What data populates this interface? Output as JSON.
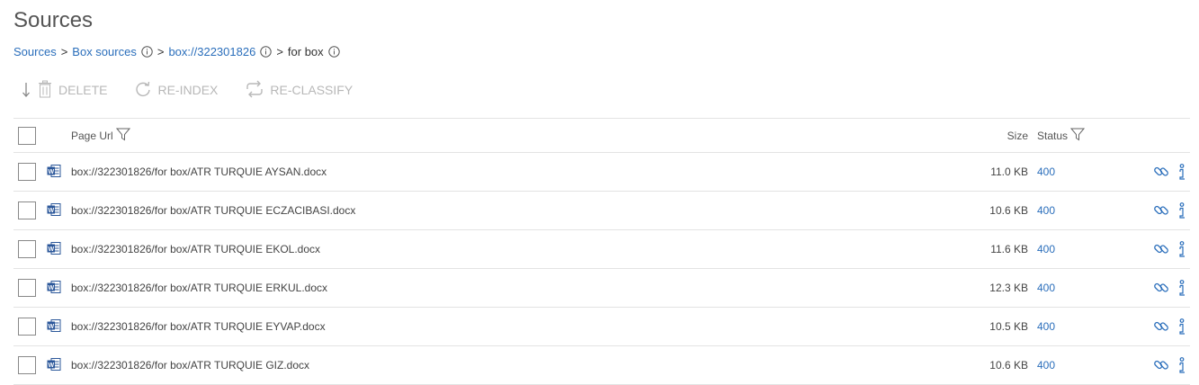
{
  "page": {
    "title": "Sources"
  },
  "breadcrumb": {
    "sources": "Sources",
    "box_sources": "Box sources",
    "source_id": "box://322301826",
    "current": "for box",
    "sep": ">"
  },
  "toolbar": {
    "delete_label": "DELETE",
    "reindex_label": "RE-INDEX",
    "reclassify_label": "RE-CLASSIFY"
  },
  "table": {
    "headers": {
      "page_url": "Page Url",
      "size": "Size",
      "status": "Status"
    },
    "rows": [
      {
        "url": "box://322301826/for box/ATR TURQUIE AYSAN.docx",
        "size": "11.0 KB",
        "status": "400",
        "icon": "word-doc-icon"
      },
      {
        "url": "box://322301826/for box/ATR TURQUIE ECZACIBASI.docx",
        "size": "10.6 KB",
        "status": "400",
        "icon": "word-doc-icon"
      },
      {
        "url": "box://322301826/for box/ATR TURQUIE EKOL.docx",
        "size": "11.6 KB",
        "status": "400",
        "icon": "word-doc-icon"
      },
      {
        "url": "box://322301826/for box/ATR TURQUIE ERKUL.docx",
        "size": "12.3 KB",
        "status": "400",
        "icon": "word-doc-icon"
      },
      {
        "url": "box://322301826/for box/ATR TURQUIE EYVAP.docx",
        "size": "10.5 KB",
        "status": "400",
        "icon": "word-doc-icon"
      },
      {
        "url": "box://322301826/for box/ATR TURQUIE GIZ.docx",
        "size": "10.6 KB",
        "status": "400",
        "icon": "word-doc-icon"
      }
    ]
  },
  "colors": {
    "link": "#2a6ebb",
    "disabled": "#b8b8b8",
    "border": "#e3e3e3",
    "word_blue": "#2b579a"
  }
}
